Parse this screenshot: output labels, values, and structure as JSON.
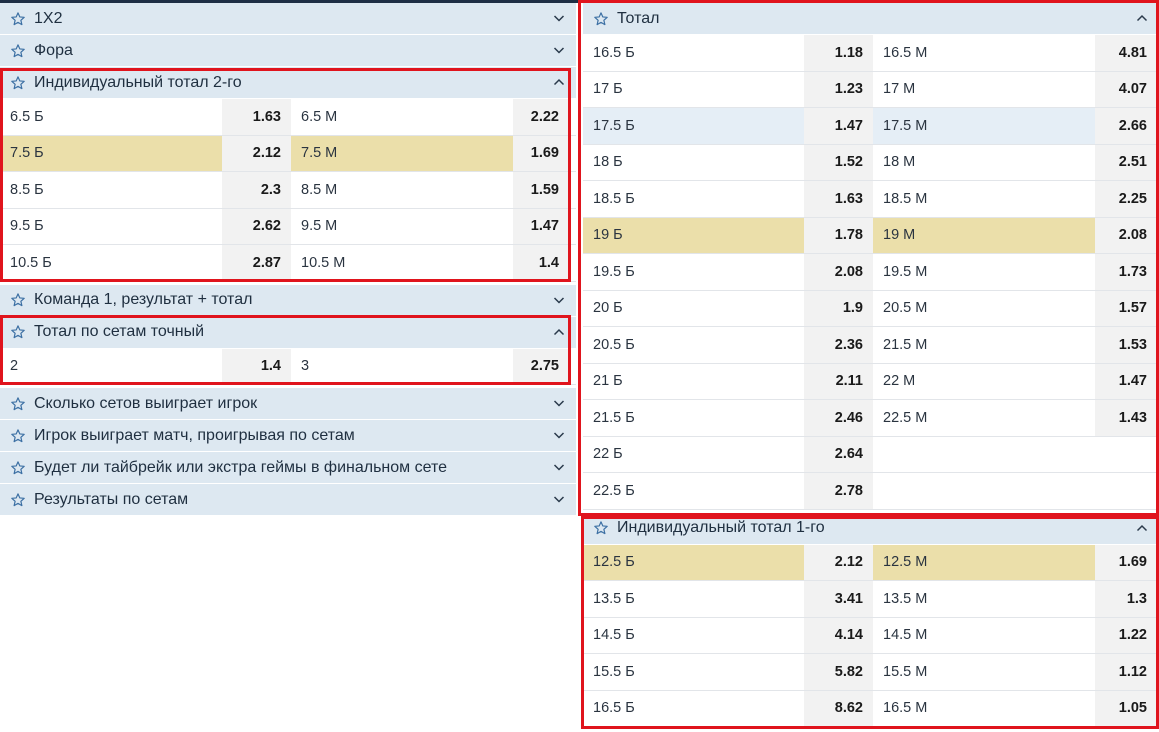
{
  "left": {
    "collapsed_top": [
      {
        "title": "1X2"
      },
      {
        "title": "Фора"
      }
    ],
    "ind_total_2": {
      "title": "Индивидуальный тотал 2-го",
      "rows": [
        {
          "over": "6.5 Б",
          "over_odd": "1.63",
          "under": "6.5 М",
          "under_odd": "2.22"
        },
        {
          "over": "7.5 Б",
          "over_odd": "2.12",
          "under": "7.5 М",
          "under_odd": "1.69"
        },
        {
          "over": "8.5 Б",
          "over_odd": "2.3",
          "under": "8.5 М",
          "under_odd": "1.59"
        },
        {
          "over": "9.5 Б",
          "over_odd": "2.62",
          "under": "9.5 М",
          "under_odd": "1.47"
        },
        {
          "over": "10.5 Б",
          "over_odd": "2.87",
          "under": "10.5 М",
          "under_odd": "1.4"
        }
      ]
    },
    "team1_result_total": {
      "title": "Команда 1, результат + тотал"
    },
    "sets_exact": {
      "title": "Тотал по сетам точный",
      "row": {
        "a": "2",
        "a_odd": "1.4",
        "b": "3",
        "b_odd": "2.75"
      }
    },
    "collapsed_bottom": [
      {
        "title": "Сколько сетов выиграет игрок"
      },
      {
        "title": "Игрок выиграет матч, проигрывая по сетам"
      },
      {
        "title": "Будет ли тайбрейк или экстра геймы в финальном сете"
      },
      {
        "title": "Результаты по сетам"
      }
    ]
  },
  "right": {
    "total": {
      "title": "Тотал",
      "rows": [
        {
          "over": "16.5 Б",
          "over_odd": "1.18",
          "under": "16.5 М",
          "under_odd": "4.81"
        },
        {
          "over": "17 Б",
          "over_odd": "1.23",
          "under": "17 М",
          "under_odd": "4.07"
        },
        {
          "over": "17.5 Б",
          "over_odd": "1.47",
          "under": "17.5 М",
          "under_odd": "2.66"
        },
        {
          "over": "18 Б",
          "over_odd": "1.52",
          "under": "18 М",
          "under_odd": "2.51"
        },
        {
          "over": "18.5 Б",
          "over_odd": "1.63",
          "under": "18.5 М",
          "under_odd": "2.25"
        },
        {
          "over": "19 Б",
          "over_odd": "1.78",
          "under": "19 М",
          "under_odd": "2.08"
        },
        {
          "over": "19.5 Б",
          "over_odd": "2.08",
          "under": "19.5 М",
          "under_odd": "1.73"
        },
        {
          "over": "20 Б",
          "over_odd": "1.9",
          "under": "20.5 М",
          "under_odd": "1.57"
        },
        {
          "over": "20.5 Б",
          "over_odd": "2.36",
          "under": "21.5 М",
          "under_odd": "1.53"
        },
        {
          "over": "21 Б",
          "over_odd": "2.11",
          "under": "22 М",
          "under_odd": "1.47"
        },
        {
          "over": "21.5 Б",
          "over_odd": "2.46",
          "under": "22.5 М",
          "under_odd": "1.43"
        },
        {
          "over": "22 Б",
          "over_odd": "2.64"
        },
        {
          "over": "22.5 Б",
          "over_odd": "2.78"
        }
      ]
    },
    "ind_total_1": {
      "title": "Индивидуальный тотал 1-го",
      "rows": [
        {
          "over": "12.5 Б",
          "over_odd": "2.12",
          "under": "12.5 М",
          "under_odd": "1.69"
        },
        {
          "over": "13.5 Б",
          "over_odd": "3.41",
          "under": "13.5 М",
          "under_odd": "1.3"
        },
        {
          "over": "14.5 Б",
          "over_odd": "4.14",
          "under": "14.5 М",
          "under_odd": "1.22"
        },
        {
          "over": "15.5 Б",
          "over_odd": "5.82",
          "under": "15.5 М",
          "under_odd": "1.12"
        },
        {
          "over": "16.5 Б",
          "over_odd": "8.62",
          "under": "16.5 М",
          "under_odd": "1.05"
        }
      ]
    }
  },
  "icons": {
    "favorite": "star-outline-icon",
    "expand": "chevron-down-icon",
    "collapse": "chevron-up-icon"
  },
  "colors": {
    "header_bg": "#dde8f1",
    "highlight": "#ebdfaa",
    "odd_bg": "#f2f2f2",
    "frame": "#e0141d",
    "top_bar": "#1e2e45"
  }
}
